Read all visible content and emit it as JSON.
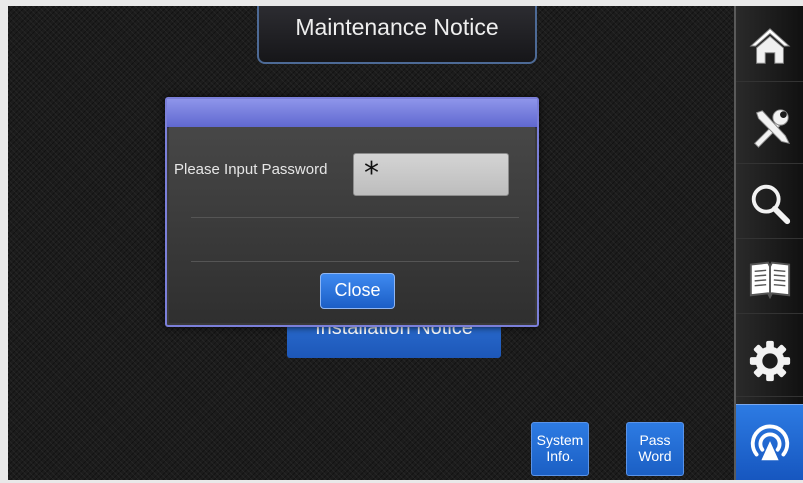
{
  "header": {
    "title": "Maintenance Notice"
  },
  "main": {
    "installation_button_label": "Installation Notice"
  },
  "bottom_buttons": {
    "system_info": [
      "System",
      "Info."
    ],
    "password": [
      "Pass",
      "Word"
    ]
  },
  "sidebar": {
    "items": [
      {
        "icon": "home-icon"
      },
      {
        "icon": "tools-icon"
      },
      {
        "icon": "search-icon"
      },
      {
        "icon": "book-icon"
      },
      {
        "icon": "gear-icon"
      },
      {
        "icon": "wireless-icon",
        "active": true
      }
    ]
  },
  "password_dialog": {
    "prompt": "Please Input Password",
    "input_value": "*",
    "close_label": "Close"
  },
  "colors": {
    "accent_blue": "#1d5fc6",
    "dialog_header": "#7a80dc",
    "background": "#1c1c1c"
  }
}
